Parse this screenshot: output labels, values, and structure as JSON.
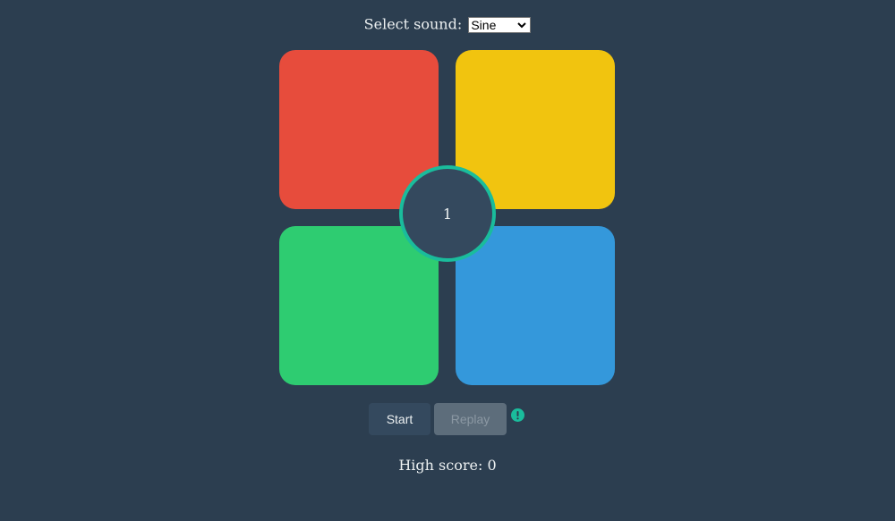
{
  "sound": {
    "label": "Select sound:",
    "selected": "Sine"
  },
  "game": {
    "counter": "1",
    "pads": [
      {
        "name": "red",
        "color": "#e74c3c"
      },
      {
        "name": "yellow",
        "color": "#f1c40f"
      },
      {
        "name": "green",
        "color": "#2ecc71"
      },
      {
        "name": "blue",
        "color": "#3498db"
      }
    ],
    "ring_color": "#1abc9c"
  },
  "controls": {
    "start_label": "Start",
    "replay_label": "Replay",
    "warning_icon": "exclamation-circle-icon"
  },
  "score": {
    "label": "High score:",
    "value": "0"
  }
}
